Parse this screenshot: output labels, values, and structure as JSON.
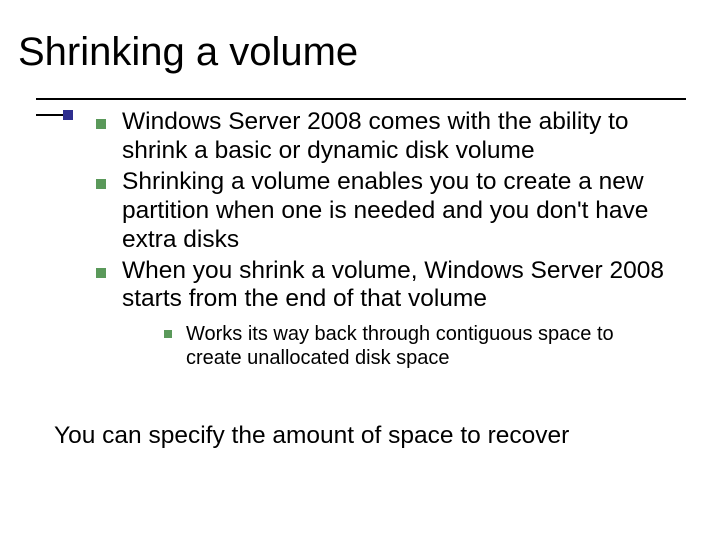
{
  "title": "Shrinking a volume",
  "bullets": [
    "Windows Server 2008 comes with the ability to shrink a basic or dynamic disk volume",
    "Shrinking a volume enables you to create a new partition when one is needed and you don't have extra disks",
    "When you shrink a volume, Windows Server 2008 starts from the end of that volume"
  ],
  "subbullet": "Works its way back through contiguous space to create unallocated disk space",
  "footer": "You can specify the amount of space to recover"
}
